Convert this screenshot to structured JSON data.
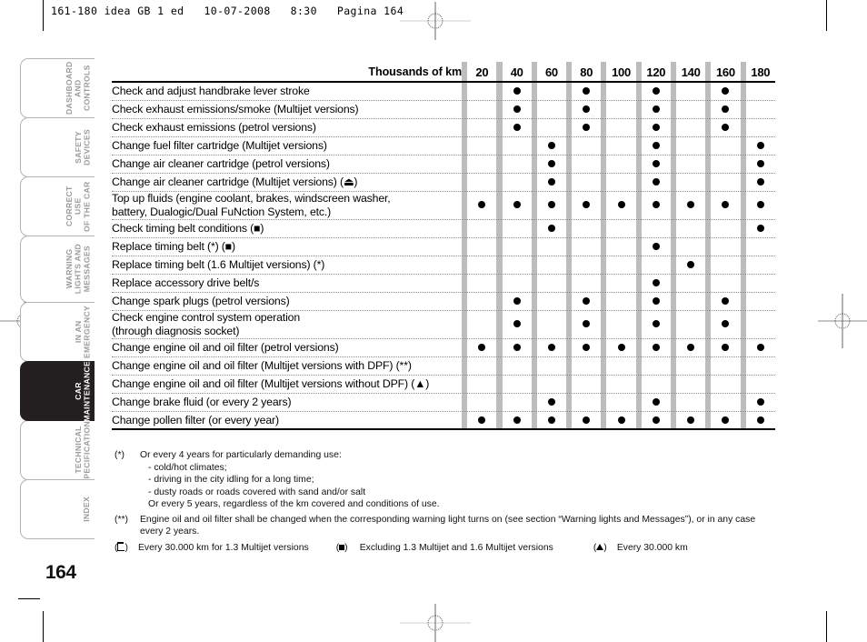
{
  "print_slug": "161-180 idea GB 1 ed   10-07-2008   8:30   Pagina 164",
  "page_number": "164",
  "sidebar": {
    "items": [
      {
        "label": "DASHBOARD\nAND CONTROLS",
        "active": false
      },
      {
        "label": "SAFETY\nDEVICES",
        "active": false
      },
      {
        "label": "CORRECT USE\nOF THE CAR",
        "active": false
      },
      {
        "label": "WARNING\nLIGHTS AND\nMESSAGES",
        "active": false
      },
      {
        "label": "IN AN\nEMERGENCY",
        "active": false
      },
      {
        "label": "CAR\nMAINTENANCE",
        "active": true
      },
      {
        "label": "TECHNICAL\nSPECIFICATIONS",
        "active": false
      },
      {
        "label": "INDEX",
        "active": false
      }
    ]
  },
  "table": {
    "header_title": "Thousands of km",
    "columns": [
      "20",
      "40",
      "60",
      "80",
      "100",
      "120",
      "140",
      "160",
      "180"
    ],
    "rows": [
      {
        "task": "Check and adjust handbrake lever stroke",
        "marks": [
          0,
          1,
          0,
          1,
          0,
          1,
          0,
          1,
          0
        ]
      },
      {
        "task": "Check exhaust emissions/smoke (Multijet versions)",
        "marks": [
          0,
          1,
          0,
          1,
          0,
          1,
          0,
          1,
          0
        ]
      },
      {
        "task": "Check exhaust emissions (petrol versions)",
        "marks": [
          0,
          1,
          0,
          1,
          0,
          1,
          0,
          1,
          0
        ]
      },
      {
        "task": "Change fuel filter cartridge (Multijet versions)",
        "marks": [
          0,
          0,
          1,
          0,
          0,
          1,
          0,
          0,
          1
        ]
      },
      {
        "task": "Change air cleaner cartridge (petrol versions)",
        "marks": [
          0,
          0,
          1,
          0,
          0,
          1,
          0,
          0,
          1
        ]
      },
      {
        "task": "Change air cleaner cartridge (Multijet versions) (⏏)",
        "marks": [
          0,
          0,
          1,
          0,
          0,
          1,
          0,
          0,
          1
        ]
      },
      {
        "task": "Top up fluids (engine coolant, brakes, windscreen washer,\nbattery, Dualogic/Dual FuNction System, etc.)",
        "marks": [
          1,
          1,
          1,
          1,
          1,
          1,
          1,
          1,
          1
        ],
        "tall": true
      },
      {
        "task": "Check timing belt conditions (■)",
        "marks": [
          0,
          0,
          1,
          0,
          0,
          0,
          0,
          0,
          1
        ]
      },
      {
        "task": "Replace timing belt (*) (■)",
        "marks": [
          0,
          0,
          0,
          0,
          0,
          1,
          0,
          0,
          0
        ]
      },
      {
        "task": "Replace timing belt (1.6 Multijet versions) (*)",
        "marks": [
          0,
          0,
          0,
          0,
          0,
          0,
          1,
          0,
          0
        ]
      },
      {
        "task": "Replace accessory drive belt/s",
        "marks": [
          0,
          0,
          0,
          0,
          0,
          1,
          0,
          0,
          0
        ]
      },
      {
        "task": "Change spark plugs (petrol versions)",
        "marks": [
          0,
          1,
          0,
          1,
          0,
          1,
          0,
          1,
          0
        ]
      },
      {
        "task": "Check engine control system operation\n(through diagnosis socket)",
        "marks": [
          0,
          1,
          0,
          1,
          0,
          1,
          0,
          1,
          0
        ],
        "tall": true
      },
      {
        "task": "Change engine oil and oil filter (petrol versions)",
        "marks": [
          1,
          1,
          1,
          1,
          1,
          1,
          1,
          1,
          1
        ]
      },
      {
        "task": "Change engine oil and oil filter (Multijet versions with DPF) (**)",
        "marks": [
          0,
          0,
          0,
          0,
          0,
          0,
          0,
          0,
          0
        ]
      },
      {
        "task": "Change engine oil and oil filter (Multijet versions without DPF) (▲)",
        "marks": [
          0,
          0,
          0,
          0,
          0,
          0,
          0,
          0,
          0
        ]
      },
      {
        "task": "Change brake fluid (or every 2 years)",
        "marks": [
          0,
          0,
          1,
          0,
          0,
          1,
          0,
          0,
          1
        ]
      },
      {
        "task": "Change pollen filter (or every year)",
        "marks": [
          1,
          1,
          1,
          1,
          1,
          1,
          1,
          1,
          1
        ]
      }
    ]
  },
  "footnotes": {
    "star": {
      "mark": "(*)",
      "lines": [
        "Or every 4 years for particularly demanding use:",
        "- cold/hot climates;",
        "- driving in the city idling for a long time;",
        "- dusty roads or roads covered with sand and/or salt",
        "Or every 5 years, regardless of the km covered and conditions of use."
      ]
    },
    "double_star": {
      "mark": "(**)",
      "text": "Engine oil and oil filter shall be changed when the corresponding warning light turns on (see section “Warning lights and Messages”), or in any case every 2 years."
    },
    "inline": [
      {
        "mark": "(⏏)",
        "text": "Every 30.000 km for 1.3 Multijet versions",
        "symbol": "flag"
      },
      {
        "mark": "(■)",
        "text": "Excluding 1.3 Multijet and 1.6 Multijet versions",
        "symbol": "square"
      },
      {
        "mark": "(▲)",
        "text": "Every 30.000 km",
        "symbol": "triangle"
      }
    ]
  }
}
